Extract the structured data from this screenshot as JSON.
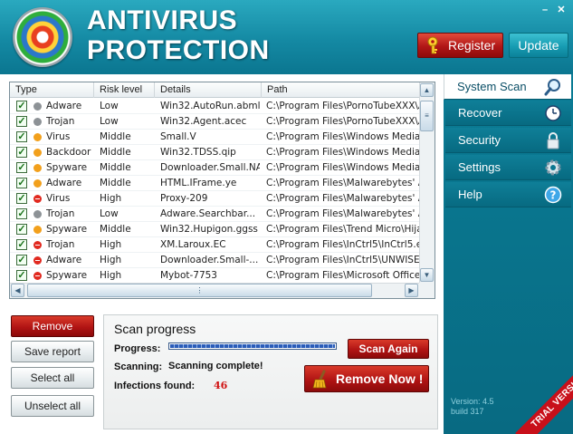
{
  "app": {
    "title_line1": "ANTIVIRUS",
    "title_line2": "PROTECTION",
    "minimize": "–",
    "close": "✕"
  },
  "header": {
    "register_label": "Register",
    "update_label": "Update"
  },
  "table": {
    "columns": [
      "Type",
      "Risk level",
      "Details",
      "Path"
    ],
    "rows": [
      {
        "icon": "gray",
        "type": "Adware",
        "risk": "Low",
        "details": "Win32.AutoRun.abml",
        "path": "C:\\Program Files\\PornoTubeXXX\\Ar"
      },
      {
        "icon": "gray",
        "type": "Trojan",
        "risk": "Low",
        "details": "Win32.Agent.acec",
        "path": "C:\\Program Files\\PornoTubeXXX\\Ar"
      },
      {
        "icon": "orange",
        "type": "Virus",
        "risk": "Middle",
        "details": "Small.V",
        "path": "C:\\Program Files\\Windows Media C"
      },
      {
        "icon": "orange",
        "type": "Backdoor",
        "risk": "Middle",
        "details": "Win32.TDSS.qip",
        "path": "C:\\Program Files\\Windows Media C"
      },
      {
        "icon": "orange",
        "type": "Spyware",
        "risk": "Middle",
        "details": "Downloader.Small.NA",
        "path": "C:\\Program Files\\Windows Media C"
      },
      {
        "icon": "orange",
        "type": "Adware",
        "risk": "Middle",
        "details": "HTML.IFrame.ye",
        "path": "C:\\Program Files\\Malwarebytes' An"
      },
      {
        "icon": "red",
        "type": "Virus",
        "risk": "High",
        "details": "Proxy-209",
        "path": "C:\\Program Files\\Malwarebytes' An"
      },
      {
        "icon": "gray",
        "type": "Trojan",
        "risk": "Low",
        "details": "Adware.Searchbar...",
        "path": "C:\\Program Files\\Malwarebytes' An"
      },
      {
        "icon": "orange",
        "type": "Spyware",
        "risk": "Middle",
        "details": "Win32.Hupigon.ggss",
        "path": "C:\\Program Files\\Trend Micro\\Hijac"
      },
      {
        "icon": "red",
        "type": "Trojan",
        "risk": "High",
        "details": "XM.Laroux.EC",
        "path": "C:\\Program Files\\InCtrl5\\InCtrl5.ex"
      },
      {
        "icon": "red",
        "type": "Adware",
        "risk": "High",
        "details": "Downloader.Small-...",
        "path": "C:\\Program Files\\InCtrl5\\UNWISE.E"
      },
      {
        "icon": "red",
        "type": "Spyware",
        "risk": "High",
        "details": "Mybot-7753",
        "path": "C:\\Program Files\\Microsoft Office\\C"
      }
    ]
  },
  "actions": {
    "remove": "Remove",
    "save_report": "Save report",
    "select_all": "Select all",
    "unselect_all": "Unselect all"
  },
  "scan": {
    "title": "Scan progress",
    "progress_label": "Progress:",
    "progress_value": 1.0,
    "scanning_label": "Scanning:",
    "scanning_value": "Scanning complete!",
    "infections_label": "Infections found:",
    "infections_value": "46",
    "scan_again": "Scan Again",
    "remove_now": "Remove Now !"
  },
  "sidebar": {
    "items": [
      {
        "label": "System Scan",
        "icon": "magnifier-icon",
        "active": true
      },
      {
        "label": "Recover",
        "icon": "clock-icon",
        "active": false
      },
      {
        "label": "Security",
        "icon": "padlock-icon",
        "active": false
      },
      {
        "label": "Settings",
        "icon": "gear-icon",
        "active": false
      },
      {
        "label": "Help",
        "icon": "question-icon",
        "active": false
      }
    ]
  },
  "footer": {
    "version": "Version: 4.5",
    "build": "build 317",
    "trial": "TRIAL VERSION"
  },
  "colors": {
    "accent_red": "#b11414",
    "teal": "#0a7d96",
    "infections": "#d01010"
  }
}
